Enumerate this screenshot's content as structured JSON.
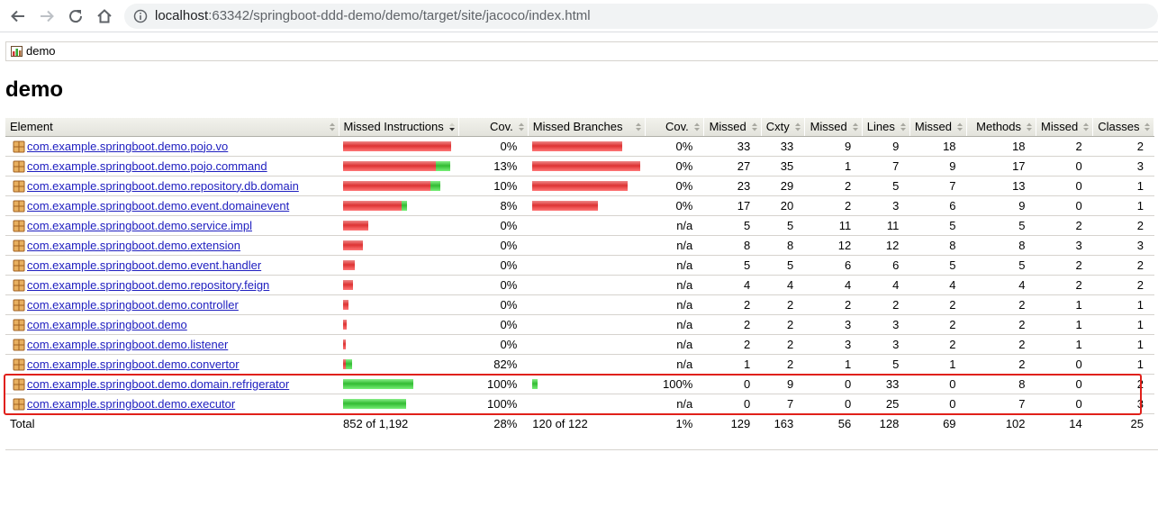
{
  "browser": {
    "url_host": "localhost",
    "url_rest": ":63342/springboot-ddd-demo/demo/target/site/jacoco/index.html"
  },
  "breadcrumb": {
    "label": "demo"
  },
  "page": {
    "title": "demo"
  },
  "table": {
    "headers": [
      "Element",
      "Missed Instructions",
      "Cov.",
      "Missed Branches",
      "Cov.",
      "Missed",
      "Cxty",
      "Missed",
      "Lines",
      "Missed",
      "Methods",
      "Missed",
      "Classes"
    ],
    "rows": [
      {
        "name": "com.example.springboot.demo.pojo.vo",
        "instr_cov": "0%",
        "branch_cov": "0%",
        "cxty_missed": "33",
        "cxty": "33",
        "lines_missed": "9",
        "lines": "9",
        "methods_missed": "18",
        "methods": "18",
        "classes_missed": "2",
        "classes": "2",
        "ibar_red": 1.0,
        "ibar_green": 0.0,
        "bbar_red": 0.83,
        "bbar_green": 0.0
      },
      {
        "name": "com.example.springboot.demo.pojo.command",
        "instr_cov": "13%",
        "branch_cov": "0%",
        "cxty_missed": "27",
        "cxty": "35",
        "lines_missed": "1",
        "lines": "7",
        "methods_missed": "9",
        "methods": "17",
        "classes_missed": "0",
        "classes": "3",
        "ibar_red": 0.86,
        "ibar_green": 0.13,
        "bbar_red": 1.0,
        "bbar_green": 0.0
      },
      {
        "name": "com.example.springboot.demo.repository.db.domain",
        "instr_cov": "10%",
        "branch_cov": "0%",
        "cxty_missed": "23",
        "cxty": "29",
        "lines_missed": "2",
        "lines": "5",
        "methods_missed": "7",
        "methods": "13",
        "classes_missed": "0",
        "classes": "1",
        "ibar_red": 0.81,
        "ibar_green": 0.09,
        "bbar_red": 0.88,
        "bbar_green": 0.0
      },
      {
        "name": "com.example.springboot.demo.event.domainevent",
        "instr_cov": "8%",
        "branch_cov": "0%",
        "cxty_missed": "17",
        "cxty": "20",
        "lines_missed": "2",
        "lines": "3",
        "methods_missed": "6",
        "methods": "9",
        "classes_missed": "0",
        "classes": "1",
        "ibar_red": 0.54,
        "ibar_green": 0.05,
        "bbar_red": 0.61,
        "bbar_green": 0.0
      },
      {
        "name": "com.example.springboot.demo.service.impl",
        "instr_cov": "0%",
        "branch_cov": "n/a",
        "cxty_missed": "5",
        "cxty": "5",
        "lines_missed": "11",
        "lines": "11",
        "methods_missed": "5",
        "methods": "5",
        "classes_missed": "2",
        "classes": "2",
        "ibar_red": 0.23,
        "ibar_green": 0.0,
        "bbar_red": 0.0,
        "bbar_green": 0.0
      },
      {
        "name": "com.example.springboot.demo.extension",
        "instr_cov": "0%",
        "branch_cov": "n/a",
        "cxty_missed": "8",
        "cxty": "8",
        "lines_missed": "12",
        "lines": "12",
        "methods_missed": "8",
        "methods": "8",
        "classes_missed": "3",
        "classes": "3",
        "ibar_red": 0.18,
        "ibar_green": 0.0,
        "bbar_red": 0.0,
        "bbar_green": 0.0
      },
      {
        "name": "com.example.springboot.demo.event.handler",
        "instr_cov": "0%",
        "branch_cov": "n/a",
        "cxty_missed": "5",
        "cxty": "5",
        "lines_missed": "6",
        "lines": "6",
        "methods_missed": "5",
        "methods": "5",
        "classes_missed": "2",
        "classes": "2",
        "ibar_red": 0.11,
        "ibar_green": 0.0,
        "bbar_red": 0.0,
        "bbar_green": 0.0
      },
      {
        "name": "com.example.springboot.demo.repository.feign",
        "instr_cov": "0%",
        "branch_cov": "n/a",
        "cxty_missed": "4",
        "cxty": "4",
        "lines_missed": "4",
        "lines": "4",
        "methods_missed": "4",
        "methods": "4",
        "classes_missed": "2",
        "classes": "2",
        "ibar_red": 0.09,
        "ibar_green": 0.0,
        "bbar_red": 0.0,
        "bbar_green": 0.0
      },
      {
        "name": "com.example.springboot.demo.controller",
        "instr_cov": "0%",
        "branch_cov": "n/a",
        "cxty_missed": "2",
        "cxty": "2",
        "lines_missed": "2",
        "lines": "2",
        "methods_missed": "2",
        "methods": "2",
        "classes_missed": "1",
        "classes": "1",
        "ibar_red": 0.05,
        "ibar_green": 0.0,
        "bbar_red": 0.0,
        "bbar_green": 0.0
      },
      {
        "name": "com.example.springboot.demo",
        "instr_cov": "0%",
        "branch_cov": "n/a",
        "cxty_missed": "2",
        "cxty": "2",
        "lines_missed": "3",
        "lines": "3",
        "methods_missed": "2",
        "methods": "2",
        "classes_missed": "1",
        "classes": "1",
        "ibar_red": 0.035,
        "ibar_green": 0.0,
        "bbar_red": 0.0,
        "bbar_green": 0.0
      },
      {
        "name": "com.example.springboot.demo.listener",
        "instr_cov": "0%",
        "branch_cov": "n/a",
        "cxty_missed": "2",
        "cxty": "2",
        "lines_missed": "3",
        "lines": "3",
        "methods_missed": "2",
        "methods": "2",
        "classes_missed": "1",
        "classes": "1",
        "ibar_red": 0.025,
        "ibar_green": 0.0,
        "bbar_red": 0.0,
        "bbar_green": 0.0
      },
      {
        "name": "com.example.springboot.demo.convertor",
        "instr_cov": "82%",
        "branch_cov": "n/a",
        "cxty_missed": "1",
        "cxty": "2",
        "lines_missed": "1",
        "lines": "5",
        "methods_missed": "1",
        "methods": "2",
        "classes_missed": "0",
        "classes": "1",
        "ibar_red": 0.012,
        "ibar_green": 0.06,
        "bbar_red": 0.0,
        "bbar_green": 0.0
      },
      {
        "name": "com.example.springboot.demo.domain.refrigerator",
        "instr_cov": "100%",
        "branch_cov": "100%",
        "cxty_missed": "0",
        "cxty": "9",
        "lines_missed": "0",
        "lines": "33",
        "methods_missed": "0",
        "methods": "8",
        "classes_missed": "0",
        "classes": "2",
        "ibar_red": 0.0,
        "ibar_green": 0.65,
        "bbar_red": 0.0,
        "bbar_green": 0.05
      },
      {
        "name": "com.example.springboot.demo.executor",
        "instr_cov": "100%",
        "branch_cov": "n/a",
        "cxty_missed": "0",
        "cxty": "7",
        "lines_missed": "0",
        "lines": "25",
        "methods_missed": "0",
        "methods": "7",
        "classes_missed": "0",
        "classes": "3",
        "ibar_red": 0.0,
        "ibar_green": 0.58,
        "bbar_red": 0.0,
        "bbar_green": 0.0
      }
    ],
    "total": {
      "label": "Total",
      "instr": "852 of 1,192",
      "instr_cov": "28%",
      "branch": "120 of 122",
      "branch_cov": "1%",
      "cxty_missed": "129",
      "cxty": "163",
      "lines_missed": "56",
      "lines": "128",
      "methods_missed": "69",
      "methods": "102",
      "classes_missed": "14",
      "classes": "25"
    }
  },
  "colors": {
    "highlight": "#e0201a",
    "link": "#2020c0",
    "covered": "#33bb33",
    "missed": "#dd3333"
  }
}
